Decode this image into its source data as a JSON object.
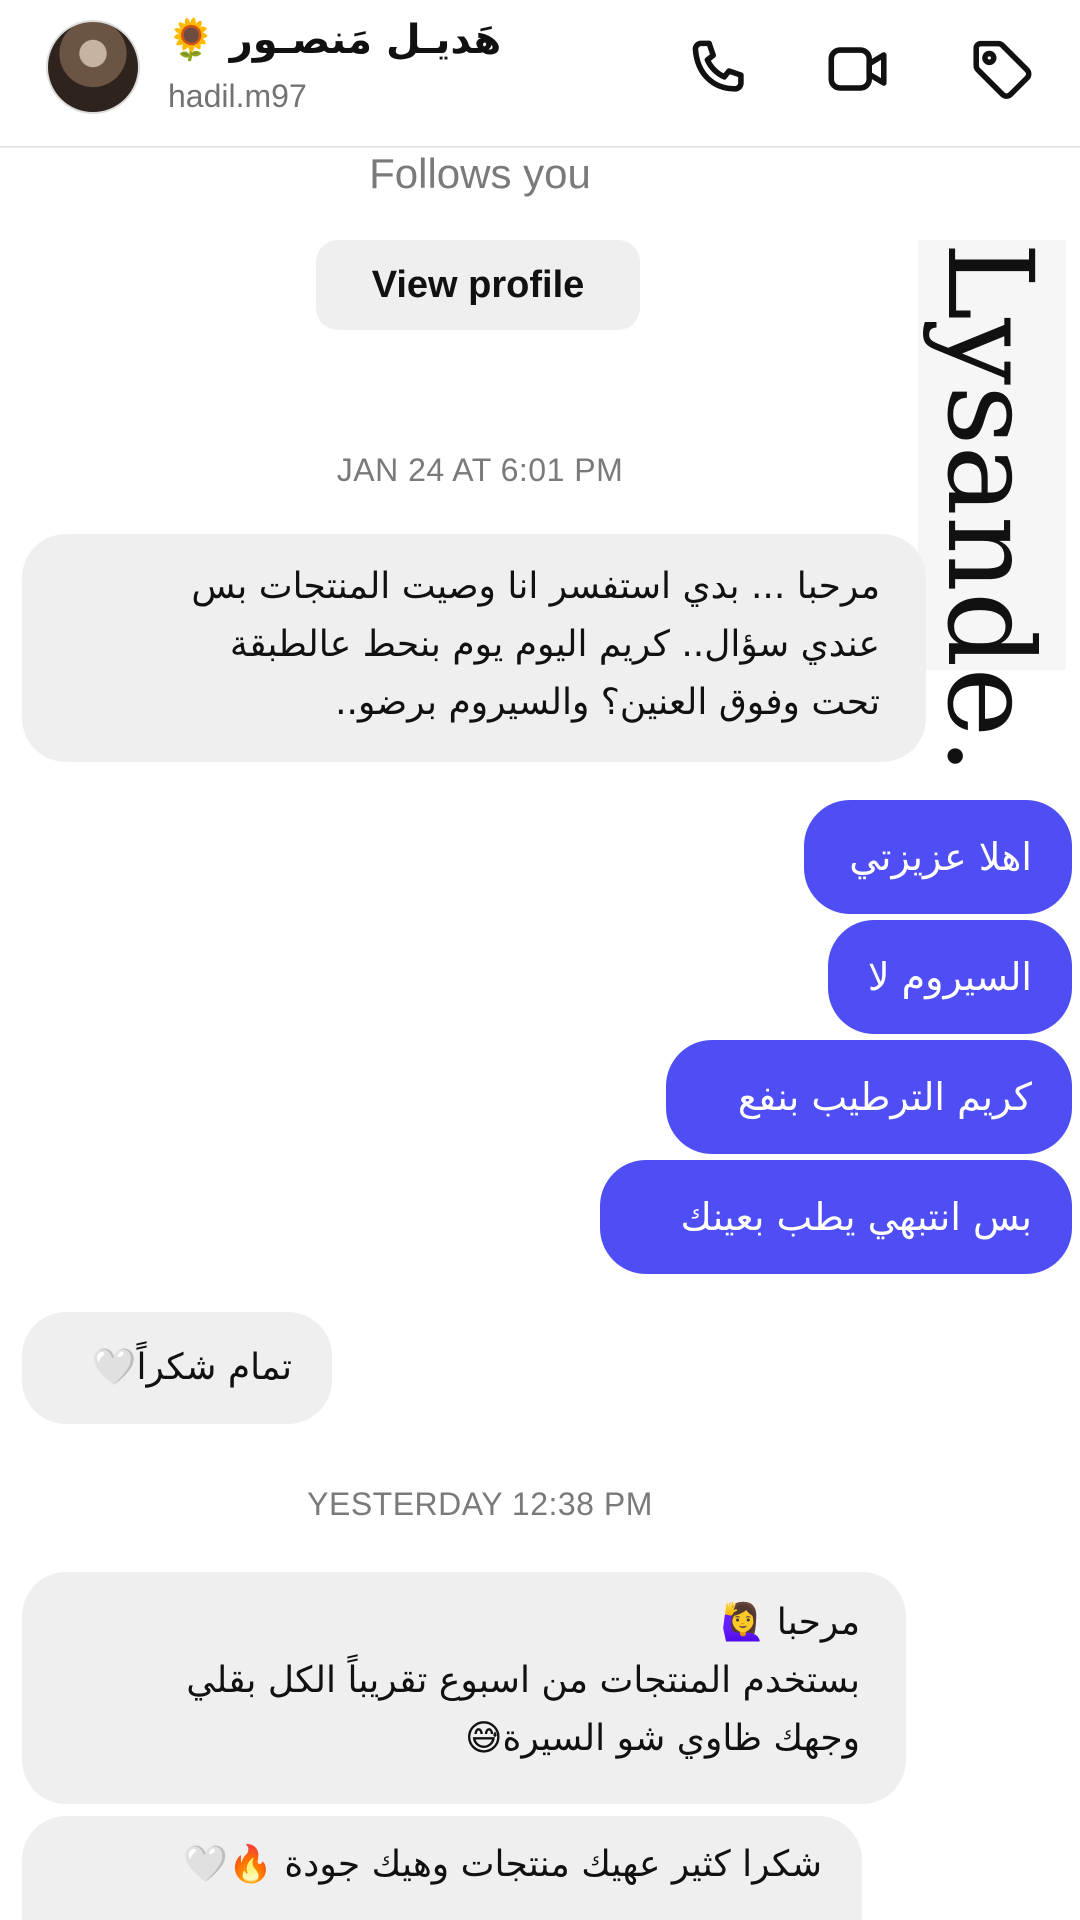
{
  "header": {
    "contact_name": "هَديـل مَنصـور 🌻",
    "handle": "hadil.m97",
    "icons": [
      "phone-icon",
      "video-icon",
      "tag-icon"
    ]
  },
  "thread": {
    "follows_text": "Follows you",
    "view_profile_label": "View profile",
    "watermark": "Lysande."
  },
  "timestamps": {
    "first": "JAN 24 AT 6:01 PM",
    "second": "YESTERDAY 12:38 PM"
  },
  "messages": {
    "m1": {
      "direction": "incoming",
      "lines": [
        "مرحبا ... بدي استفسر انا وصيت المنتجات بس",
        "عندي سؤال.. كريم اليوم يوم  بنحط عالطبقة",
        "تحت وفوق العنين؟ والسيروم برضو.."
      ]
    },
    "m2": {
      "direction": "outgoing",
      "text": "اهلا عزيزتي"
    },
    "m3": {
      "direction": "outgoing",
      "text": "السيروم لا"
    },
    "m4": {
      "direction": "outgoing",
      "text": "كريم الترطيب بنفع"
    },
    "m5": {
      "direction": "outgoing",
      "text": "بس انتبهي يطب بعينك"
    },
    "m6": {
      "direction": "incoming",
      "text": "تمام شكراً🤍"
    },
    "m7": {
      "direction": "incoming",
      "lines": [
        "مرحبا 🙋‍♀️",
        "بستخدم المنتجات من اسبوع تقريباً الكل بقلي",
        "وجهك ظاوي شو السيرة😅"
      ]
    },
    "m8": {
      "direction": "incoming",
      "text": "شكرا كثير عهيك  منتجات وهيك  جودة  🔥🤍"
    }
  },
  "colors": {
    "outgoing_bubble": "#4f4ef4",
    "incoming_bubble": "#efefef",
    "meta_text": "#7a7a7a"
  }
}
